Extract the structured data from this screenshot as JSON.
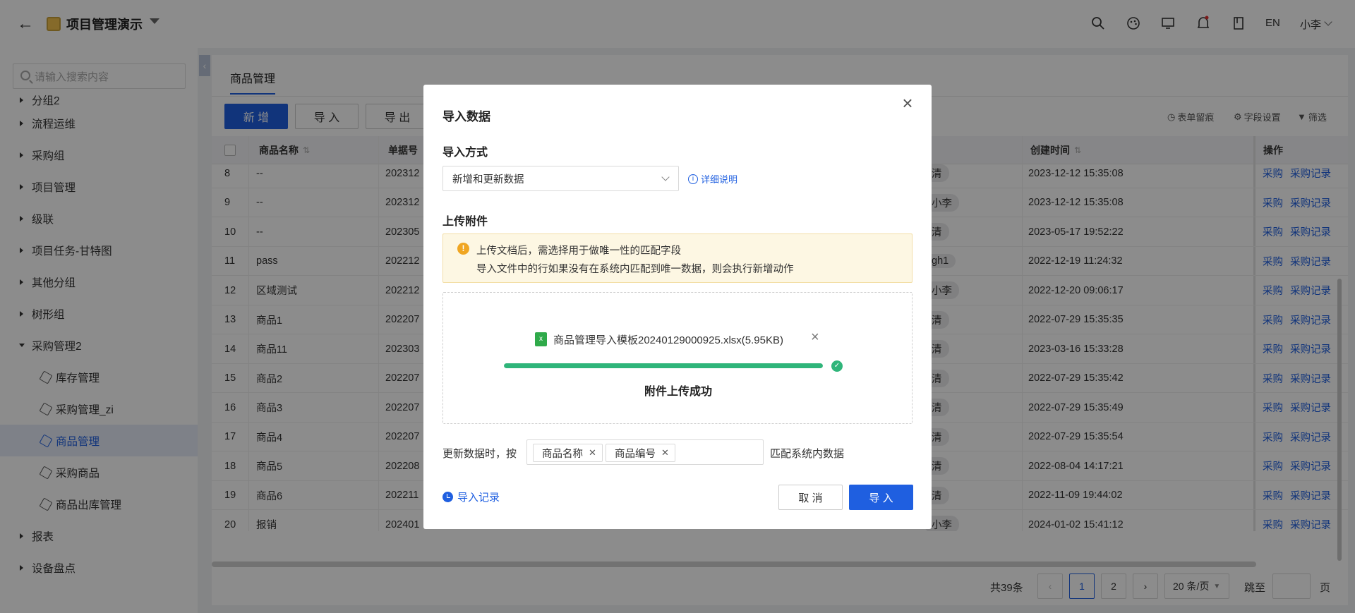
{
  "topbar": {
    "title": "项目管理演示",
    "lang": "EN",
    "user": "小李"
  },
  "sidebar": {
    "search_placeholder": "请输入搜索内容",
    "items": [
      {
        "label": "分组2",
        "type": "group"
      },
      {
        "label": "流程运维",
        "type": "group"
      },
      {
        "label": "采购组",
        "type": "group"
      },
      {
        "label": "项目管理",
        "type": "group"
      },
      {
        "label": "级联",
        "type": "group"
      },
      {
        "label": "项目任务-甘特图",
        "type": "group"
      },
      {
        "label": "其他分组",
        "type": "group"
      },
      {
        "label": "树形组",
        "type": "group"
      },
      {
        "label": "采购管理2",
        "type": "open"
      },
      {
        "label": "库存管理",
        "type": "child"
      },
      {
        "label": "采购管理_zi",
        "type": "child"
      },
      {
        "label": "商品管理",
        "type": "child-active"
      },
      {
        "label": "采购商品",
        "type": "child"
      },
      {
        "label": "商品出库管理",
        "type": "child"
      },
      {
        "label": "报表",
        "type": "group"
      },
      {
        "label": "设备盘点",
        "type": "group"
      }
    ]
  },
  "main": {
    "tab": "商品管理",
    "btn_add": "新 增",
    "btn_import": "导 入",
    "btn_export": "导 出",
    "tool_form": "表单留痕",
    "tool_fields": "字段设置",
    "tool_filter": "筛选",
    "columns": {
      "name": "商品名称",
      "no": "单据号",
      "created": "创建时间",
      "ops": "操作"
    },
    "rows": [
      {
        "idx": "8",
        "name": "--",
        "no": "202312",
        "user": "清",
        "created": "2023-12-12 15:35:08"
      },
      {
        "idx": "9",
        "name": "--",
        "no": "202312",
        "user": "小李",
        "created": "2023-12-12 15:35:08"
      },
      {
        "idx": "10",
        "name": "--",
        "no": "202305",
        "user": "清",
        "created": "2023-05-17 19:52:22"
      },
      {
        "idx": "11",
        "name": "pass",
        "no": "202212",
        "user": "gh1",
        "created": "2022-12-19 11:24:32"
      },
      {
        "idx": "12",
        "name": "区域测试",
        "no": "202212",
        "user": "小李",
        "created": "2022-12-20 09:06:17"
      },
      {
        "idx": "13",
        "name": "商品1",
        "no": "202207",
        "user": "清",
        "created": "2022-07-29 15:35:35"
      },
      {
        "idx": "14",
        "name": "商品11",
        "no": "202303",
        "user": "清",
        "created": "2023-03-16 15:33:28"
      },
      {
        "idx": "15",
        "name": "商品2",
        "no": "202207",
        "user": "清",
        "created": "2022-07-29 15:35:42"
      },
      {
        "idx": "16",
        "name": "商品3",
        "no": "202207",
        "user": "清",
        "created": "2022-07-29 15:35:49"
      },
      {
        "idx": "17",
        "name": "商品4",
        "no": "202207",
        "user": "清",
        "created": "2022-07-29 15:35:54"
      },
      {
        "idx": "18",
        "name": "商品5",
        "no": "202208",
        "user": "清",
        "created": "2022-08-04 14:17:21"
      },
      {
        "idx": "19",
        "name": "商品6",
        "no": "202211",
        "user": "清",
        "created": "2022-11-09 19:44:02"
      },
      {
        "idx": "20",
        "name": "报销",
        "no": "202401",
        "user": "小李",
        "created": "2024-01-02 15:41:12"
      }
    ],
    "op1": "采购",
    "op2": "采购记录",
    "total": "共39条",
    "page1": "1",
    "page2": "2",
    "page_size": "20 条/页",
    "goto": "跳至",
    "page_unit": "页"
  },
  "modal": {
    "title": "导入数据",
    "mode_label": "导入方式",
    "mode_value": "新增和更新数据",
    "help": "详细说明",
    "upload_label": "上传附件",
    "warn_line1": "上传文档后，需选择用于做唯一性的匹配字段",
    "warn_line2": "导入文件中的行如果没有在系统内匹配到唯一数据，则会执行新增动作",
    "file_name": "商品管理导入模板20240129000925.xlsx(5.95KB)",
    "progress": 1.0,
    "upload_ok": "附件上传成功",
    "match_before": "更新数据时，按",
    "tags": [
      "商品名称",
      "商品编号"
    ],
    "match_after": "匹配系统内数据",
    "record": "导入记录",
    "cancel": "取 消",
    "ok": "导 入"
  },
  "colors": {
    "primary": "#1f5fe0",
    "success": "#2fb57a",
    "warn": "#f0a622"
  }
}
